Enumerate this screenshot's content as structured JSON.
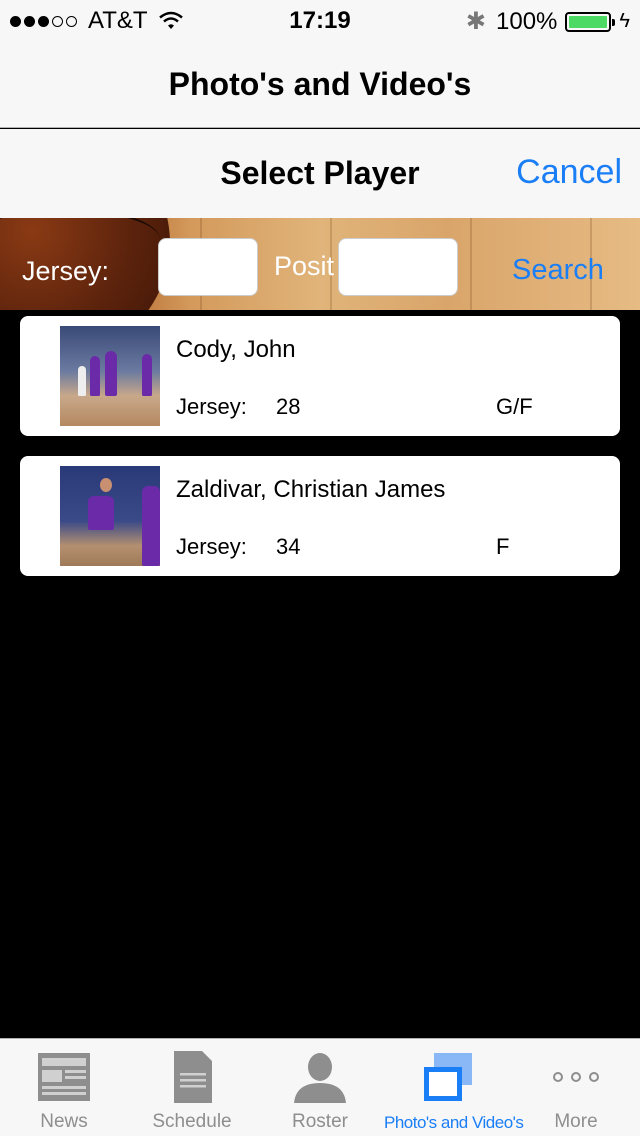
{
  "status_bar": {
    "carrier": "AT&T",
    "time": "17:19",
    "battery": "100%",
    "signal_bars": 3,
    "signal_total": 5
  },
  "nav": {
    "title": "Photo's and Video's"
  },
  "modal": {
    "title": "Select Player",
    "cancel_label": "Cancel"
  },
  "search": {
    "jersey_label": "Jersey:",
    "position_label": "Posit",
    "jersey_value": "",
    "position_value": "",
    "search_label": "Search"
  },
  "players": [
    {
      "name": "Cody, John",
      "jersey_label": "Jersey:",
      "jersey": "28",
      "position": "G/F"
    },
    {
      "name": "Zaldivar, Christian James",
      "jersey_label": "Jersey:",
      "jersey": "34",
      "position": "F"
    }
  ],
  "tabs": [
    {
      "label": "News",
      "icon": "newspaper-icon"
    },
    {
      "label": "Schedule",
      "icon": "document-icon"
    },
    {
      "label": "Roster",
      "icon": "person-icon"
    },
    {
      "label": "Photo's and Video's",
      "icon": "photos-icon",
      "active": true
    },
    {
      "label": "More",
      "icon": "more-dots-icon"
    }
  ],
  "colors": {
    "accent": "#1a7ef6",
    "battery": "#4cd964",
    "list_background": "#000000"
  }
}
